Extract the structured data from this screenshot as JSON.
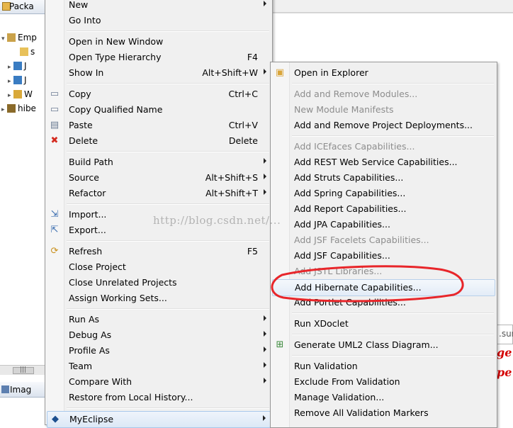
{
  "package_explorer": {
    "tab_label": "Packa",
    "tree": [
      {
        "label": "Emp",
        "indent": 0,
        "twisty": "▾"
      },
      {
        "label": "s",
        "indent": 2,
        "twisty": ""
      },
      {
        "label": "J",
        "indent": 1,
        "twisty": "▸"
      },
      {
        "label": "J",
        "indent": 1,
        "twisty": "▸"
      },
      {
        "label": "W",
        "indent": 1,
        "twisty": "▸"
      },
      {
        "label": "hibe",
        "indent": 0,
        "twisty": "▸"
      }
    ],
    "scroll_grip": "|||",
    "bottom_tab_label": "Imag"
  },
  "editor_fragments": {
    "text": ".sur",
    "red_line1": "ge",
    "red_line2": "pe"
  },
  "watermark": "http://blog.csdn.net/...",
  "context_menu": [
    {
      "type": "item",
      "label": "New",
      "shortcut": "",
      "submenu": true,
      "icon": "",
      "icon_name": ""
    },
    {
      "type": "item",
      "label": "Go Into",
      "shortcut": "",
      "submenu": false,
      "icon": "",
      "icon_name": ""
    },
    {
      "type": "sep"
    },
    {
      "type": "item",
      "label": "Open in New Window",
      "shortcut": "",
      "submenu": false,
      "icon": "",
      "icon_name": ""
    },
    {
      "type": "item",
      "label": "Open Type Hierarchy",
      "shortcut": "F4",
      "submenu": false,
      "icon": "",
      "icon_name": ""
    },
    {
      "type": "item",
      "label": "Show In",
      "shortcut": "Alt+Shift+W",
      "submenu": true,
      "icon": "",
      "icon_name": ""
    },
    {
      "type": "sep"
    },
    {
      "type": "item",
      "label": "Copy",
      "shortcut": "Ctrl+C",
      "submenu": false,
      "icon": "▭",
      "icon_name": "copy-icon"
    },
    {
      "type": "item",
      "label": "Copy Qualified Name",
      "shortcut": "",
      "submenu": false,
      "icon": "▭",
      "icon_name": "copy-qualified-name-icon"
    },
    {
      "type": "item",
      "label": "Paste",
      "shortcut": "Ctrl+V",
      "submenu": false,
      "icon": "▤",
      "icon_name": "paste-icon"
    },
    {
      "type": "item",
      "label": "Delete",
      "shortcut": "Delete",
      "submenu": false,
      "icon": "✖",
      "icon_name": "delete-icon"
    },
    {
      "type": "sep"
    },
    {
      "type": "item",
      "label": "Build Path",
      "shortcut": "",
      "submenu": true,
      "icon": "",
      "icon_name": ""
    },
    {
      "type": "item",
      "label": "Source",
      "shortcut": "Alt+Shift+S",
      "submenu": true,
      "icon": "",
      "icon_name": ""
    },
    {
      "type": "item",
      "label": "Refactor",
      "shortcut": "Alt+Shift+T",
      "submenu": true,
      "icon": "",
      "icon_name": ""
    },
    {
      "type": "sep"
    },
    {
      "type": "item",
      "label": "Import...",
      "shortcut": "",
      "submenu": false,
      "icon": "⇲",
      "icon_name": "import-icon"
    },
    {
      "type": "item",
      "label": "Export...",
      "shortcut": "",
      "submenu": false,
      "icon": "⇱",
      "icon_name": "export-icon"
    },
    {
      "type": "sep"
    },
    {
      "type": "item",
      "label": "Refresh",
      "shortcut": "F5",
      "submenu": false,
      "icon": "⟳",
      "icon_name": "refresh-icon"
    },
    {
      "type": "item",
      "label": "Close Project",
      "shortcut": "",
      "submenu": false,
      "icon": "",
      "icon_name": ""
    },
    {
      "type": "item",
      "label": "Close Unrelated Projects",
      "shortcut": "",
      "submenu": false,
      "icon": "",
      "icon_name": ""
    },
    {
      "type": "item",
      "label": "Assign Working Sets...",
      "shortcut": "",
      "submenu": false,
      "icon": "",
      "icon_name": ""
    },
    {
      "type": "sep"
    },
    {
      "type": "item",
      "label": "Run As",
      "shortcut": "",
      "submenu": true,
      "icon": "",
      "icon_name": ""
    },
    {
      "type": "item",
      "label": "Debug As",
      "shortcut": "",
      "submenu": true,
      "icon": "",
      "icon_name": ""
    },
    {
      "type": "item",
      "label": "Profile As",
      "shortcut": "",
      "submenu": true,
      "icon": "",
      "icon_name": ""
    },
    {
      "type": "item",
      "label": "Team",
      "shortcut": "",
      "submenu": true,
      "icon": "",
      "icon_name": ""
    },
    {
      "type": "item",
      "label": "Compare With",
      "shortcut": "",
      "submenu": true,
      "icon": "",
      "icon_name": ""
    },
    {
      "type": "item",
      "label": "Restore from Local History...",
      "shortcut": "",
      "submenu": false,
      "icon": "",
      "icon_name": ""
    },
    {
      "type": "sep"
    },
    {
      "type": "item",
      "label": "MyEclipse",
      "shortcut": "",
      "submenu": true,
      "icon": "◆",
      "icon_name": "myeclipse-icon",
      "state": "highlighted"
    }
  ],
  "submenu": [
    {
      "type": "item",
      "label": "Open in Explorer",
      "disabled": false,
      "icon": "▣",
      "icon_name": "open-in-explorer-icon"
    },
    {
      "type": "sep"
    },
    {
      "type": "item",
      "label": "Add and Remove Modules...",
      "disabled": true,
      "icon": "",
      "icon_name": ""
    },
    {
      "type": "item",
      "label": "New Module Manifests",
      "disabled": true,
      "icon": "",
      "icon_name": ""
    },
    {
      "type": "item",
      "label": "Add and Remove Project Deployments...",
      "disabled": false,
      "icon": "",
      "icon_name": ""
    },
    {
      "type": "sep"
    },
    {
      "type": "item",
      "label": "Add ICEfaces Capabilities...",
      "disabled": true,
      "icon": "",
      "icon_name": ""
    },
    {
      "type": "item",
      "label": "Add REST Web Service Capabilities...",
      "disabled": false,
      "icon": "",
      "icon_name": ""
    },
    {
      "type": "item",
      "label": "Add Struts Capabilities...",
      "disabled": false,
      "icon": "",
      "icon_name": ""
    },
    {
      "type": "item",
      "label": "Add Spring Capabilities...",
      "disabled": false,
      "icon": "",
      "icon_name": ""
    },
    {
      "type": "item",
      "label": "Add Report Capabilities...",
      "disabled": false,
      "icon": "",
      "icon_name": ""
    },
    {
      "type": "item",
      "label": "Add JPA Capabilities...",
      "disabled": false,
      "icon": "",
      "icon_name": ""
    },
    {
      "type": "item",
      "label": "Add JSF Facelets Capabilities...",
      "disabled": true,
      "icon": "",
      "icon_name": ""
    },
    {
      "type": "item",
      "label": "Add JSF Capabilities...",
      "disabled": false,
      "icon": "",
      "icon_name": ""
    },
    {
      "type": "item",
      "label": "Add JSTL Libraries...",
      "disabled": true,
      "icon": "",
      "icon_name": ""
    },
    {
      "type": "item",
      "label": "Add Hibernate Capabilities...",
      "disabled": false,
      "icon": "",
      "icon_name": "",
      "state": "selected"
    },
    {
      "type": "item",
      "label": "Add Portlet Capabilities...",
      "disabled": false,
      "icon": "",
      "icon_name": ""
    },
    {
      "type": "sep"
    },
    {
      "type": "item",
      "label": "Run XDoclet",
      "disabled": false,
      "icon": "",
      "icon_name": ""
    },
    {
      "type": "sep"
    },
    {
      "type": "item",
      "label": "Generate UML2 Class Diagram...",
      "disabled": false,
      "icon": "⊞",
      "icon_name": "uml-diagram-icon"
    },
    {
      "type": "sep"
    },
    {
      "type": "item",
      "label": "Run Validation",
      "disabled": false,
      "icon": "",
      "icon_name": ""
    },
    {
      "type": "item",
      "label": "Exclude From Validation",
      "disabled": false,
      "icon": "",
      "icon_name": ""
    },
    {
      "type": "item",
      "label": "Manage Validation...",
      "disabled": false,
      "icon": "",
      "icon_name": ""
    },
    {
      "type": "item",
      "label": "Remove All Validation Markers",
      "disabled": false,
      "icon": "",
      "icon_name": ""
    }
  ],
  "colors": {
    "annotation": "#e8262a",
    "hover": "#dce8f6"
  }
}
